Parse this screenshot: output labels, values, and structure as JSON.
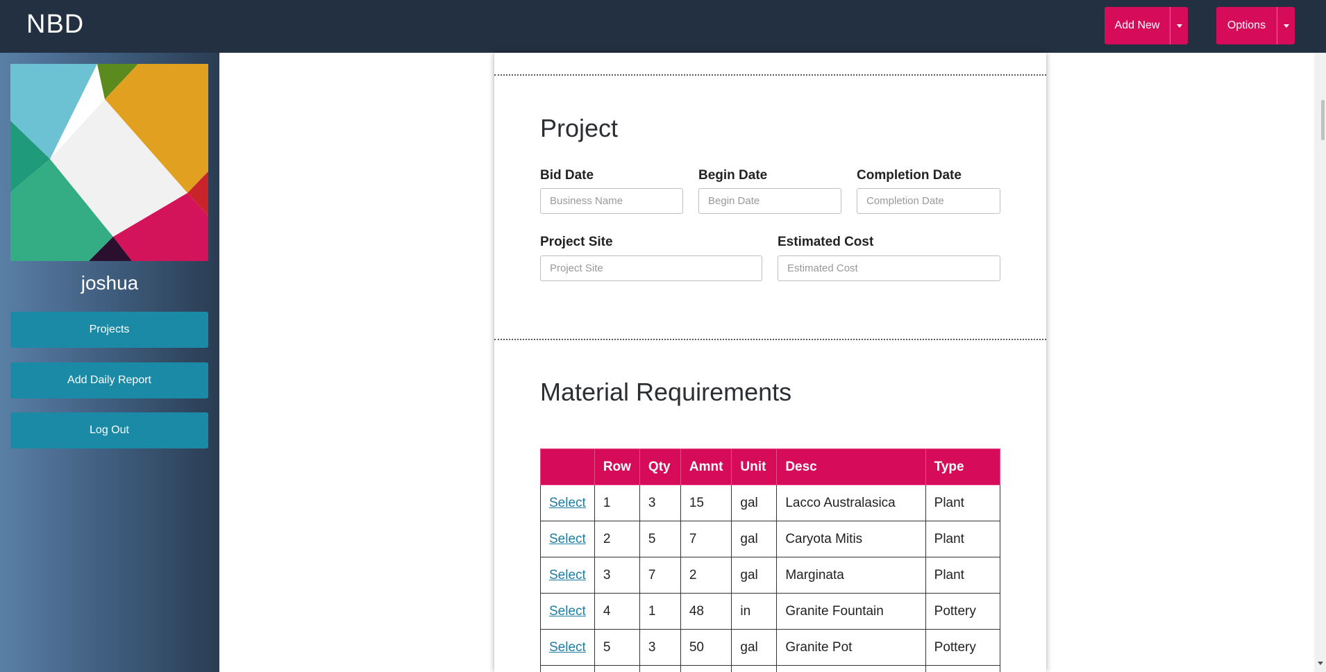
{
  "app": {
    "brand": "NBD"
  },
  "header": {
    "add_new_label": "Add New",
    "options_label": "Options"
  },
  "sidebar": {
    "username": "joshua",
    "buttons": [
      "Projects",
      "Add Daily Report",
      "Log Out"
    ]
  },
  "project": {
    "title": "Project",
    "fields": {
      "bid_date": {
        "label": "Bid Date",
        "placeholder": "Business Name"
      },
      "begin_date": {
        "label": "Begin Date",
        "placeholder": "Begin Date"
      },
      "completion_date": {
        "label": "Completion Date",
        "placeholder": "Completion Date"
      },
      "project_site": {
        "label": "Project Site",
        "placeholder": "Project Site"
      },
      "estimated_cost": {
        "label": "Estimated Cost",
        "placeholder": "Estimated Cost"
      }
    }
  },
  "materials": {
    "title": "Material Requirements",
    "columns": [
      "",
      "Row",
      "Qty",
      "Amnt",
      "Unit",
      "Desc",
      "Type"
    ],
    "select_label": "Select",
    "rows": [
      {
        "row": "1",
        "qty": "3",
        "amnt": "15",
        "unit": "gal",
        "desc": "Lacco Australasica",
        "type": "Plant"
      },
      {
        "row": "2",
        "qty": "5",
        "amnt": "7",
        "unit": "gal",
        "desc": "Caryota Mitis",
        "type": "Plant"
      },
      {
        "row": "3",
        "qty": "7",
        "amnt": "2",
        "unit": "gal",
        "desc": "Marginata",
        "type": "Plant"
      },
      {
        "row": "4",
        "qty": "1",
        "amnt": "48",
        "unit": "in",
        "desc": "Granite Fountain",
        "type": "Pottery"
      },
      {
        "row": "5",
        "qty": "3",
        "amnt": "50",
        "unit": "gal",
        "desc": "Granite Pot",
        "type": "Pottery"
      },
      {
        "row": "",
        "qty": "",
        "amnt": "",
        "unit": "",
        "desc": "",
        "type": ""
      }
    ]
  },
  "colors": {
    "topbar": "#223041",
    "accent": "#d60c5a",
    "sidebar_button": "#1b8aa6",
    "link": "#1b7da0"
  }
}
